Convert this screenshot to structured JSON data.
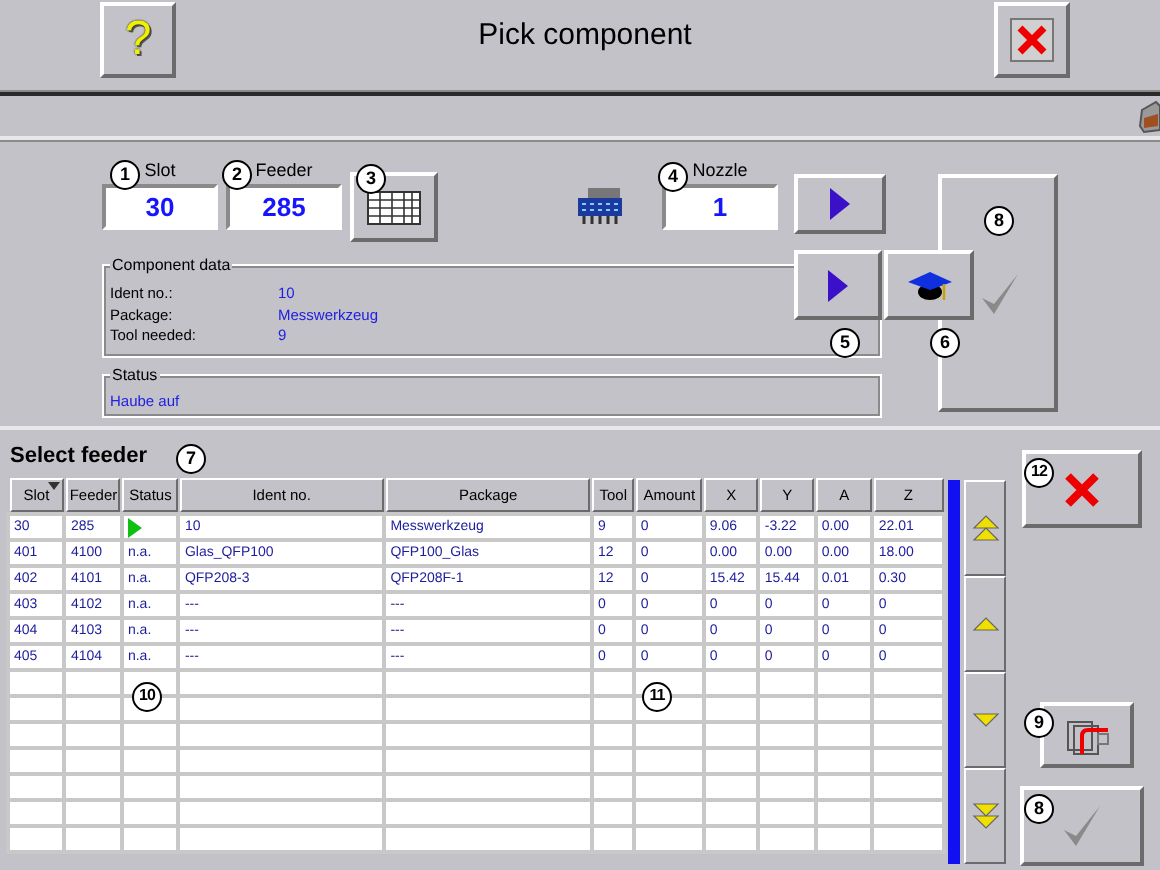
{
  "title": "Pick component",
  "header_buttons": [
    {
      "kind": "help",
      "label": "?"
    },
    {
      "kind": "close"
    }
  ],
  "fields": [
    {
      "label": "Slot",
      "value": "30",
      "callout": "1"
    },
    {
      "label": "Feeder",
      "value": "285",
      "callout": "2"
    }
  ],
  "feeder_list_button": {
    "callout": "3"
  },
  "nozzle": {
    "label": "Nozzle",
    "value": "1",
    "callout": "4"
  },
  "component_data": {
    "title": "Component data",
    "rows": [
      {
        "label": "Ident no.:",
        "value": "10"
      },
      {
        "label": "Package:",
        "value": "Messwerkzeug"
      },
      {
        "label": "Tool needed:",
        "value": "9"
      }
    ]
  },
  "status": {
    "title": "Status",
    "text": "Haube auf"
  },
  "action_buttons": [
    {
      "kind": "nozzle-next"
    },
    {
      "kind": "next",
      "callout": "5"
    },
    {
      "kind": "teach",
      "callout": "6"
    },
    {
      "kind": "confirm",
      "callout": "8"
    }
  ],
  "feeder_table": {
    "title": "Select feeder",
    "callout": "7",
    "columns": [
      {
        "label": "Slot",
        "sorted": true
      },
      {
        "label": "Feeder",
        "sorted": false
      },
      {
        "label": "Status",
        "sorted": false,
        "callout": "10"
      },
      {
        "label": "Ident no.",
        "sorted": false
      },
      {
        "label": "Package",
        "sorted": false
      },
      {
        "label": "Tool",
        "sorted": false
      },
      {
        "label": "Amount",
        "sorted": false,
        "callout": "11"
      },
      {
        "label": "X",
        "sorted": false
      },
      {
        "label": "Y",
        "sorted": false
      },
      {
        "label": "A",
        "sorted": false
      },
      {
        "label": "Z",
        "sorted": false
      }
    ],
    "rows": [
      {
        "active": true,
        "cells": [
          "30",
          "285",
          "",
          "10",
          "Messwerkzeug",
          "9",
          "0",
          "9.06",
          "-3.22",
          "0.00",
          "22.01"
        ]
      },
      {
        "active": false,
        "cells": [
          "401",
          "4100",
          "n.a.",
          "Glas_QFP100",
          "QFP100_Glas",
          "12",
          "0",
          "0.00",
          "0.00",
          "0.00",
          "18.00"
        ]
      },
      {
        "active": false,
        "cells": [
          "402",
          "4101",
          "n.a.",
          "QFP208-3",
          "QFP208F-1",
          "12",
          "0",
          "15.42",
          "15.44",
          "0.01",
          "0.30"
        ]
      },
      {
        "active": false,
        "cells": [
          "403",
          "4102",
          "n.a.",
          "---",
          "---",
          "0",
          "0",
          "0",
          "0",
          "0",
          "0"
        ]
      },
      {
        "active": false,
        "cells": [
          "404",
          "4103",
          "n.a.",
          "---",
          "---",
          "0",
          "0",
          "0",
          "0",
          "0",
          "0"
        ]
      },
      {
        "active": false,
        "cells": [
          "405",
          "4104",
          "n.a.",
          "---",
          "---",
          "0",
          "0",
          "0",
          "0",
          "0",
          "0"
        ]
      }
    ]
  },
  "scroll_buttons": [
    {
      "kind": "page-up"
    },
    {
      "kind": "up"
    },
    {
      "kind": "down"
    },
    {
      "kind": "page-down"
    }
  ],
  "side_buttons": [
    {
      "kind": "cancel",
      "callout": "12"
    },
    {
      "kind": "copy",
      "callout": "9"
    },
    {
      "kind": "confirm",
      "callout": "8"
    }
  ]
}
